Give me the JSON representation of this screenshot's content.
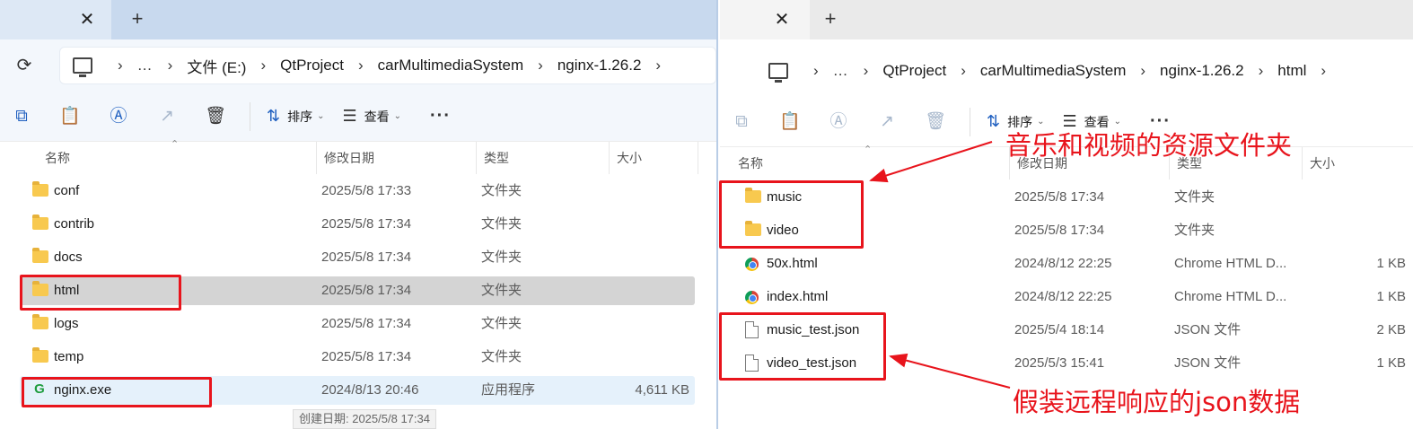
{
  "left": {
    "tab_close": "✕",
    "tab_new": "+",
    "breadcrumb": [
      {
        "label": "…"
      },
      {
        "label": "文件 (E:)"
      },
      {
        "label": "QtProject"
      },
      {
        "label": "carMultimediaSystem"
      },
      {
        "label": "nginx-1.26.2"
      }
    ],
    "toolbar": {
      "sort_label": "排序",
      "view_label": "查看",
      "more": "···"
    },
    "columns": {
      "name": "名称",
      "date": "修改日期",
      "type": "类型",
      "size": "大小"
    },
    "rows": [
      {
        "name": "conf",
        "date": "2025/5/8 17:33",
        "type": "文件夹",
        "size": "",
        "icon": "folder-icon"
      },
      {
        "name": "contrib",
        "date": "2025/5/8 17:34",
        "type": "文件夹",
        "size": "",
        "icon": "folder-icon"
      },
      {
        "name": "docs",
        "date": "2025/5/8 17:34",
        "type": "文件夹",
        "size": "",
        "icon": "folder-icon"
      },
      {
        "name": "html",
        "date": "2025/5/8 17:34",
        "type": "文件夹",
        "size": "",
        "icon": "folder-icon",
        "selected": true
      },
      {
        "name": "logs",
        "date": "2025/5/8 17:34",
        "type": "文件夹",
        "size": "",
        "icon": "folder-icon"
      },
      {
        "name": "temp",
        "date": "2025/5/8 17:34",
        "type": "文件夹",
        "size": "",
        "icon": "folder-icon"
      },
      {
        "name": "nginx.exe",
        "date": "2024/8/13 20:46",
        "type": "应用程序",
        "size": "4,611 KB",
        "icon": "nginx-exe-icon",
        "hover": true
      }
    ],
    "tooltip": "创建日期: 2025/5/8 17:34"
  },
  "right": {
    "tab_close": "✕",
    "tab_new": "+",
    "breadcrumb": [
      {
        "label": "…"
      },
      {
        "label": "QtProject"
      },
      {
        "label": "carMultimediaSystem"
      },
      {
        "label": "nginx-1.26.2"
      },
      {
        "label": "html"
      }
    ],
    "toolbar": {
      "sort_label": "排序",
      "view_label": "查看",
      "more": "···"
    },
    "columns": {
      "name": "名称",
      "date": "修改日期",
      "type": "类型",
      "size": "大小"
    },
    "rows": [
      {
        "name": "music",
        "date": "2025/5/8 17:34",
        "type": "文件夹",
        "size": "",
        "icon": "folder-icon"
      },
      {
        "name": "video",
        "date": "2025/5/8 17:34",
        "type": "文件夹",
        "size": "",
        "icon": "folder-icon"
      },
      {
        "name": "50x.html",
        "date": "2024/8/12 22:25",
        "type": "Chrome HTML D...",
        "size": "1 KB",
        "icon": "chrome-html-icon"
      },
      {
        "name": "index.html",
        "date": "2024/8/12 22:25",
        "type": "Chrome HTML D...",
        "size": "1 KB",
        "icon": "chrome-html-icon"
      },
      {
        "name": "music_test.json",
        "date": "2025/5/4 18:14",
        "type": "JSON 文件",
        "size": "2 KB",
        "icon": "json-file-icon"
      },
      {
        "name": "video_test.json",
        "date": "2025/5/3 15:41",
        "type": "JSON 文件",
        "size": "1 KB",
        "icon": "json-file-icon"
      }
    ]
  },
  "annotations": {
    "top": "音乐和视频的资源文件夹",
    "bottom": "假装远程响应的json数据"
  },
  "colors": {
    "annotation_red": "#e8141c",
    "selected_row": "#d4d4d4",
    "hover_row": "#e5f1fb"
  }
}
